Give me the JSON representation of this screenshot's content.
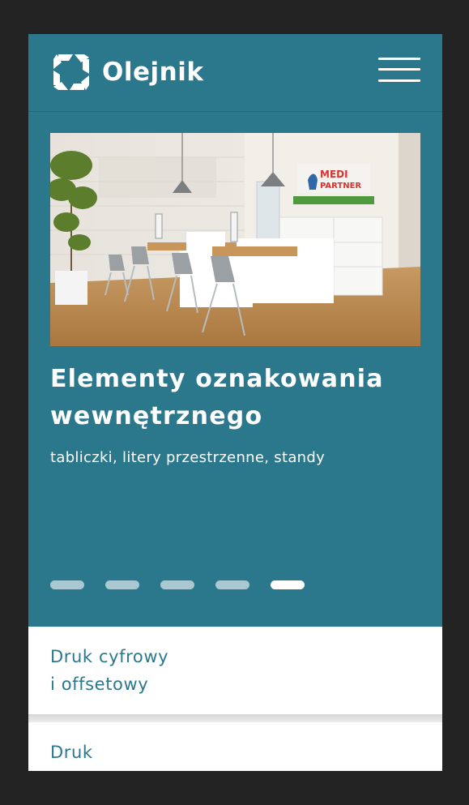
{
  "header": {
    "brand": "Olejnik",
    "logo_icon": "olejnik-logo-icon",
    "menu_icon": "hamburger-menu-icon"
  },
  "hero": {
    "title": "Elementy oznakowania wewnętrznego",
    "subtitle": "tabliczki, litery przestrzenne, standy",
    "image_sign_line1": "MEDI",
    "image_sign_line2": "PARTNER",
    "slides_total": 5,
    "active_slide": 5
  },
  "services": [
    {
      "label": "Druk cyfrowy\ni offsetowy"
    },
    {
      "label": "Druk\nwielkoformatowy"
    }
  ],
  "colors": {
    "brand_teal": "#2b788d",
    "page_dark": "#232323",
    "dot_inactive": "#a9c8d2"
  }
}
